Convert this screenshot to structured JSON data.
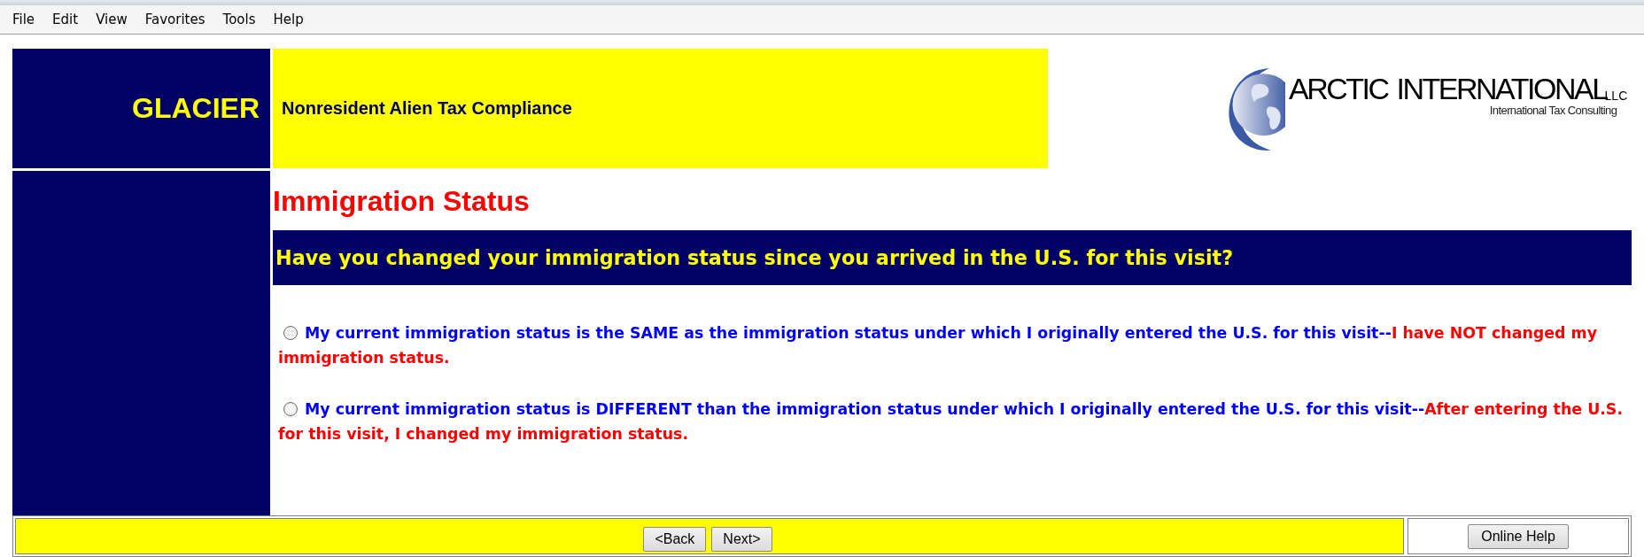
{
  "menu_bar": [
    "File",
    "Edit",
    "View",
    "Favorites",
    "Tools",
    "Help"
  ],
  "header": {
    "app_name": "GLACIER",
    "subtitle": "Nonresident Alien Tax Compliance",
    "logo": {
      "words": [
        "ARCTIC",
        "INTERNATIONAL"
      ],
      "suffix": "LLC",
      "tagline": "International Tax Consulting"
    }
  },
  "page_title": "Immigration Status",
  "question": "Have you changed your immigration status since you arrived in the U.S. for this visit?",
  "options": [
    {
      "text": "My current immigration status is the SAME as the immigration status under which I originally entered the U.S. for this visit--",
      "note": "I have NOT changed my immigration status.",
      "selected": false
    },
    {
      "text": "My current immigration status is DIFFERENT than the immigration status under which I originally entered the U.S. for this visit--",
      "note": "After entering the U.S. for this visit, I changed my immigration status.",
      "selected": false
    }
  ],
  "footer": {
    "buttons": [
      "<Back",
      "Next>"
    ],
    "help_button": "Online Help"
  }
}
